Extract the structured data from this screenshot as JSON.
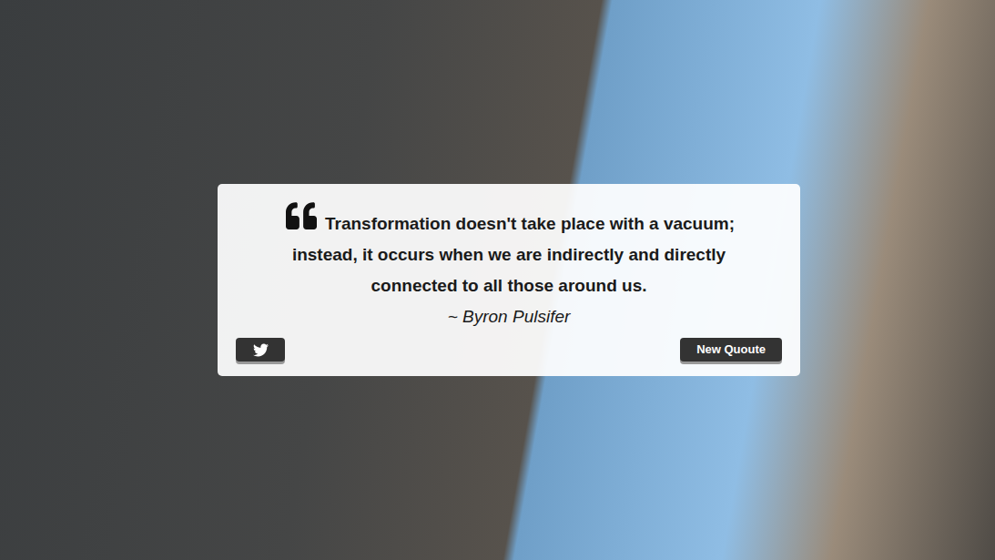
{
  "quote": {
    "text": "Transformation doesn't take place with a vacuum; instead, it occurs when we are indirectly and directly connected to all those around us.",
    "author": "~ Byron Pulsifer"
  },
  "buttons": {
    "new_quote": "New Quoute"
  }
}
